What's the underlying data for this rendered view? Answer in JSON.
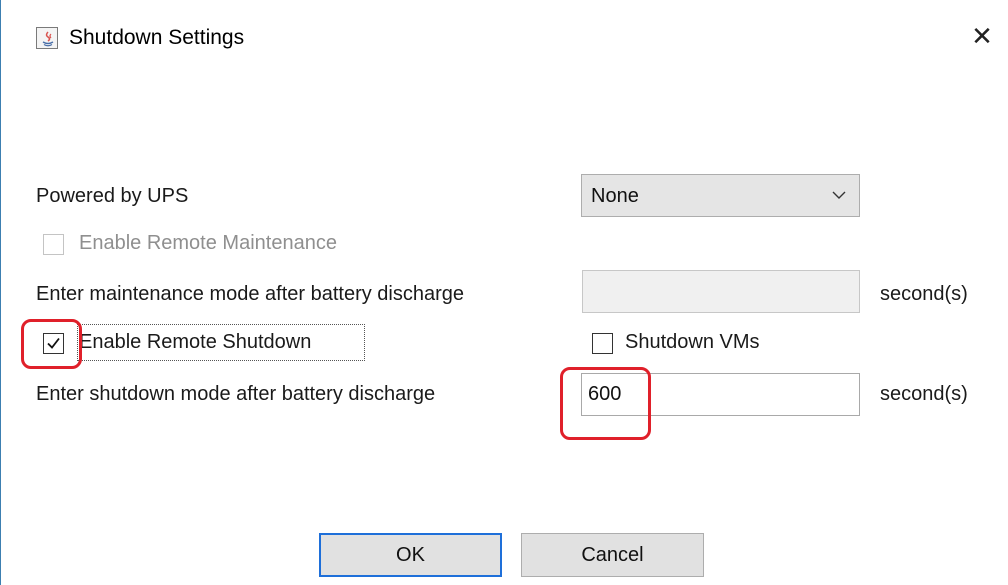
{
  "window": {
    "title": "Shutdown Settings",
    "close_glyph": "✕",
    "icon": "java-app-icon"
  },
  "powered_by_ups": {
    "label": "Powered by UPS",
    "selected": "None"
  },
  "remote_maintenance": {
    "label": "Enable Remote Maintenance",
    "checked": false,
    "enabled": false
  },
  "maintenance_mode": {
    "label": "Enter maintenance mode after battery discharge",
    "value": "",
    "unit": "second(s)"
  },
  "remote_shutdown": {
    "label": "Enable Remote Shutdown",
    "checked": true
  },
  "shutdown_vms": {
    "label": "Shutdown VMs",
    "checked": false
  },
  "shutdown_mode": {
    "label": "Enter shutdown mode after battery discharge",
    "value": "600",
    "unit": "second(s)"
  },
  "buttons": {
    "ok": "OK",
    "cancel": "Cancel"
  },
  "colors": {
    "highlight": "#e0202a",
    "window_border": "#3c7fb1",
    "default_button_border": "#1e6fd9"
  }
}
